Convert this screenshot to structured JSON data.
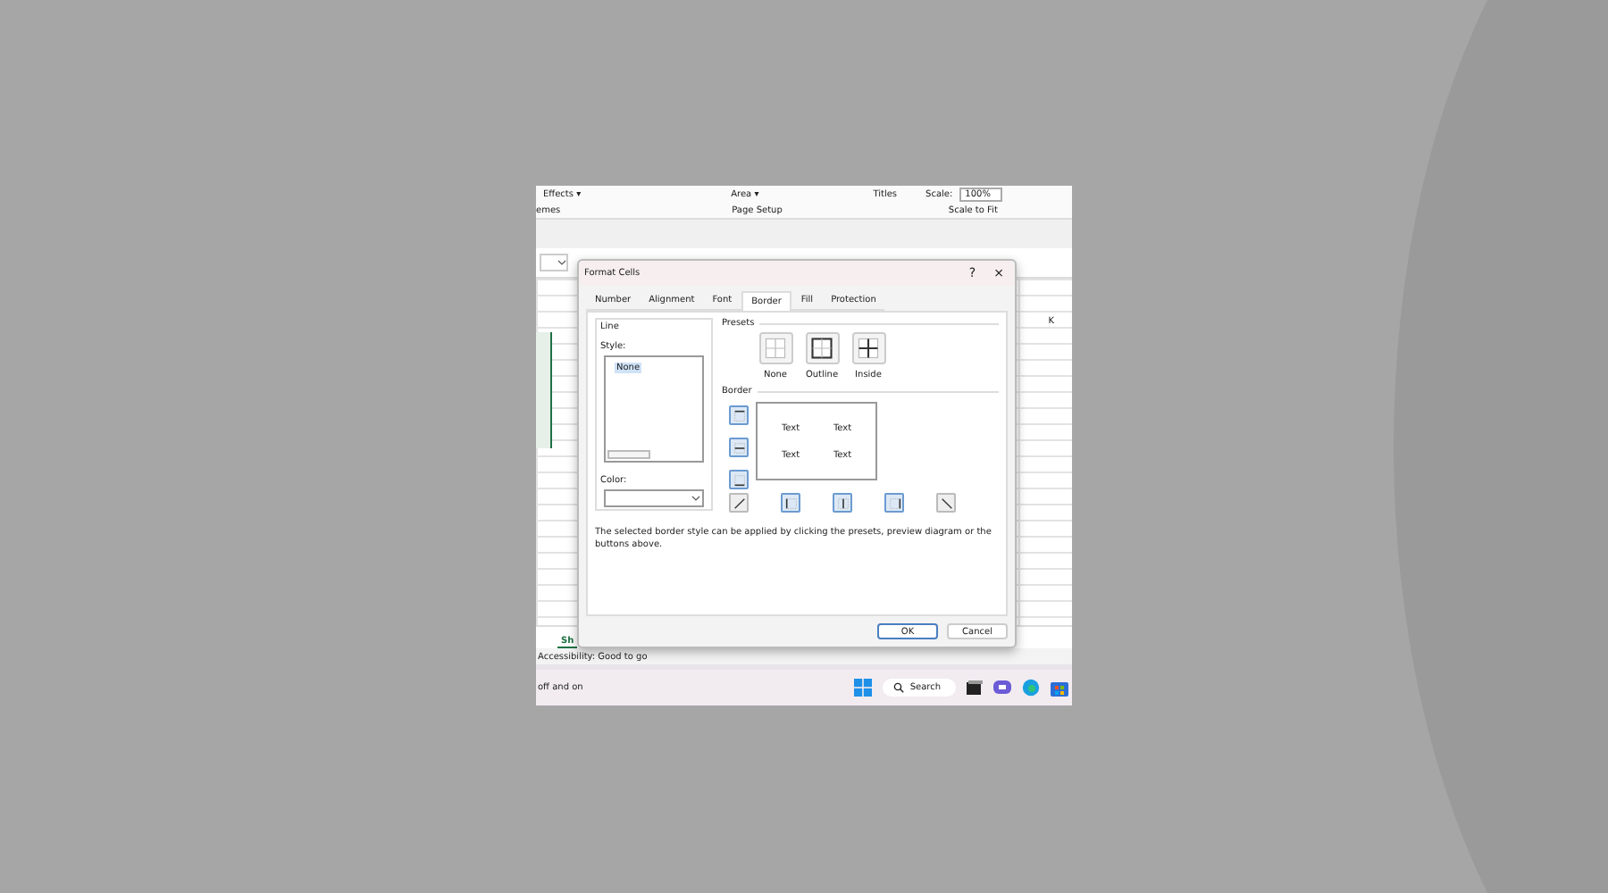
{
  "ribbon": {
    "items": [
      "Effects ▾",
      "Area ▾",
      "Titles"
    ],
    "scale_label": "Scale:",
    "scale_value": "100%",
    "groups": [
      "emes",
      "Page Setup",
      "Scale to Fit"
    ]
  },
  "sheet": {
    "column_header": "K",
    "sheet_tab": "Sh"
  },
  "status_bar": "Accessibility: Good to go",
  "taskbar": {
    "left_text": "off and on",
    "search": "Search"
  },
  "dialog": {
    "title": "Format Cells",
    "help": "?",
    "close": "×",
    "tabs": [
      {
        "label": "Number",
        "selected": false
      },
      {
        "label": "Alignment",
        "selected": false
      },
      {
        "label": "Font",
        "selected": false
      },
      {
        "label": "Border",
        "selected": true
      },
      {
        "label": "Fill",
        "selected": false
      },
      {
        "label": "Protection",
        "selected": false
      }
    ],
    "line": {
      "title": "Line",
      "style_label": "Style:",
      "styles": [
        {
          "label": "None",
          "selected": true
        }
      ],
      "color_label": "Color:"
    },
    "presets": {
      "title": "Presets",
      "items": [
        {
          "label": "None",
          "kind": "none"
        },
        {
          "label": "Outline",
          "kind": "outline"
        },
        {
          "label": "Inside",
          "kind": "inside"
        }
      ]
    },
    "border": {
      "title": "Border",
      "preview_texts": [
        "Text",
        "Text",
        "Text",
        "Text"
      ]
    },
    "description": "The selected border style can be applied by clicking the presets, preview diagram or the buttons above.",
    "buttons": [
      {
        "label": "OK",
        "default": true
      },
      {
        "label": "Cancel",
        "default": false
      }
    ]
  }
}
